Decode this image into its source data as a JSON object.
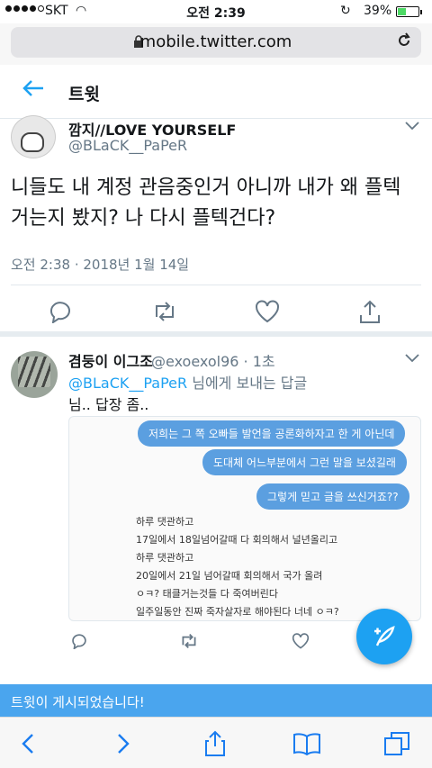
{
  "status": {
    "carrier": "SKT",
    "time": "오전 2:39",
    "battery_percent_text": "39%",
    "battery_level": 0.39
  },
  "browser": {
    "url": "mobile.twitter.com"
  },
  "header": {
    "title": "트윗"
  },
  "tweet": {
    "display_name": "깜지//LOVE YOURSELF",
    "handle": "@BLaCK__PaPeR",
    "text": "니들도 내 계정 관음중인거 아니까 내가 왜 플텍 거는지 봤지? 나 다시 플텍건다?",
    "timestamp": "오전 2:38 · 2018년 1월 14일"
  },
  "reply": {
    "display_name": "겸둥이 이그조",
    "handle_time": "@exoexol96 · 1초",
    "mention": "@BLaCK__PaPeR",
    "mention_suffix": " 님에게 보내는 답글",
    "text": "님.. 답장 좀..",
    "image": {
      "bubbles": [
        "저희는 그 쪽 오빠들 발언을 공론화하자고 한 게 아닌데",
        "도대체 어느부분에서 그런 말을 보셨길래",
        "그렇게 믿고 글을 쓰신거죠??"
      ],
      "lines": [
        "하루 댓관하고",
        "17일에서 18일넘어갈때 다 회의해서 널년올리고",
        "하루 댓관하고",
        "20일에서 21일 넘어갈때 회의해서 국가 올려",
        "ㅇㅋ? 태클거는것들 다 죽여버린다",
        "일주일동안 진짜 죽자살자로 해야된다 너네 ㅇㅋ?"
      ]
    }
  },
  "toast": {
    "text": "트윗이 게시되었습니다!"
  },
  "colors": {
    "accent": "#1da1f2",
    "toast": "#4aa5ee",
    "bubble": "#5b9fe0"
  }
}
